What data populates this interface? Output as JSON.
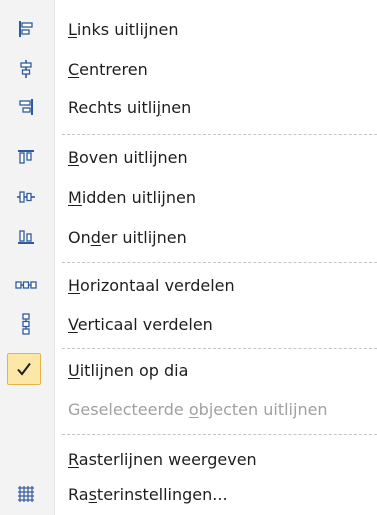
{
  "menu": {
    "items": [
      {
        "pre": "",
        "key": "L",
        "post": "inks uitlijnen",
        "icon": "align-left-icon"
      },
      {
        "pre": "",
        "key": "C",
        "post": "entreren",
        "icon": "align-center-icon"
      },
      {
        "pre": "Rechts uitli",
        "key": "j",
        "post": "nen",
        "icon": "align-right-icon"
      },
      {
        "pre": "",
        "key": "B",
        "post": "oven uitlijnen",
        "icon": "align-top-icon"
      },
      {
        "pre": "",
        "key": "M",
        "post": "idden uitlijnen",
        "icon": "align-middle-icon"
      },
      {
        "pre": "On",
        "key": "d",
        "post": "er uitlijnen",
        "icon": "align-bottom-icon"
      },
      {
        "pre": "",
        "key": "H",
        "post": "orizontaal verdelen",
        "icon": "distribute-horizontal-icon"
      },
      {
        "pre": "",
        "key": "V",
        "post": "erticaal verdelen",
        "icon": "distribute-vertical-icon"
      },
      {
        "pre": "",
        "key": "U",
        "post": "itlijnen op dia",
        "icon": "checkmark-icon",
        "checked": true
      },
      {
        "pre": "Geselecteerde ",
        "key": "o",
        "post": "bjecten uitlijnen",
        "icon": "",
        "disabled": true
      },
      {
        "pre": "",
        "key": "R",
        "post": "asterlijnen weergeven",
        "icon": ""
      },
      {
        "pre": "Ra",
        "key": "s",
        "post": "terinstellingen...",
        "icon": "grid-settings-icon"
      }
    ]
  },
  "colors": {
    "icon_blue": "#2f5a9e",
    "check_bg": "#fde7a6",
    "check_border": "#e3b44a",
    "disabled_text": "#a0a0a0"
  }
}
